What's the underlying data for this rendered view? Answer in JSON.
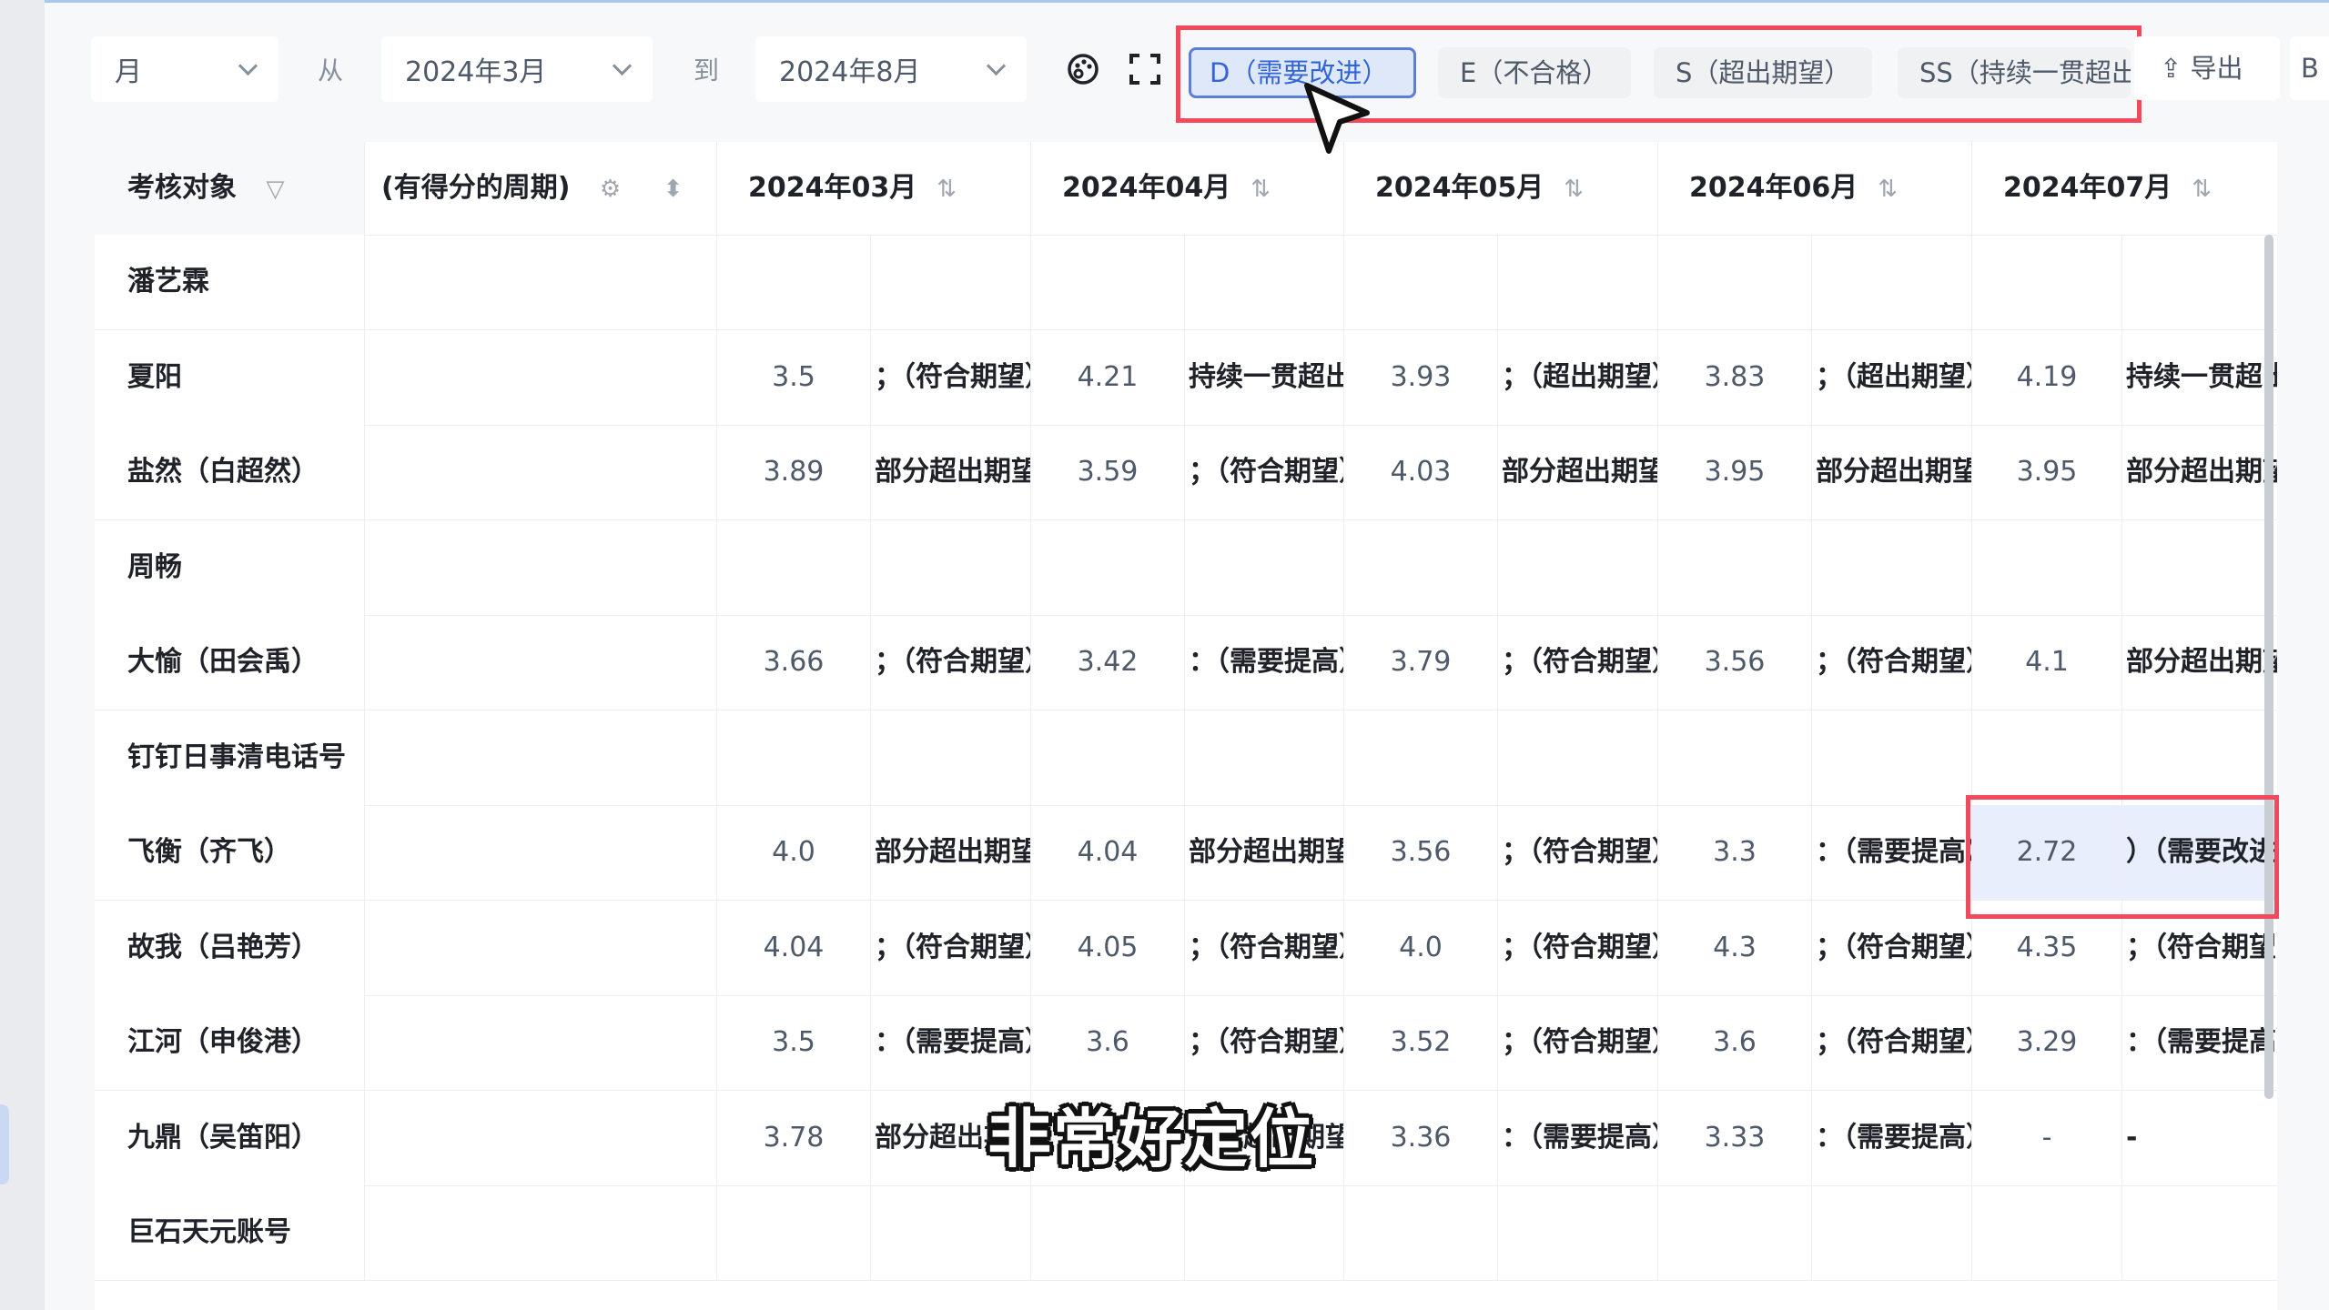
{
  "filters": {
    "period_type": "月",
    "from_label": "从",
    "from_value": "2024年3月",
    "to_label": "到",
    "to_value": "2024年8月"
  },
  "grade_chips": [
    {
      "label": "D（需要改进）",
      "active": true
    },
    {
      "label": "E（不合格）",
      "active": false
    },
    {
      "label": "S（超出期望）",
      "active": false
    },
    {
      "label": "SS（持续一贯超出期望）",
      "active": false
    }
  ],
  "toolbar": {
    "palette_icon": "palette-icon",
    "fullscreen_icon": "fullscreen-icon",
    "export_label": "导出",
    "extra_label": "B"
  },
  "table": {
    "headers": {
      "object": "考核对象",
      "period": "(有得分的周期)",
      "months": [
        "2024年03月",
        "2024年04月",
        "2024年05月",
        "2024年06月",
        "2024年07月"
      ]
    },
    "rows": [
      {
        "name": "潘艺霖",
        "cells": [
          [
            "",
            ""
          ],
          [
            "",
            ""
          ],
          [
            "",
            ""
          ],
          [
            "",
            ""
          ],
          [
            "",
            ""
          ]
        ]
      },
      {
        "name": "夏阳",
        "cells": [
          [
            "3.5",
            "；（符合期望）"
          ],
          [
            "4.21",
            "持续一贯超出期望"
          ],
          [
            "3.93",
            "；（超出期望）"
          ],
          [
            "3.83",
            "；（超出期望）"
          ],
          [
            "4.19",
            "持续一贯超出期望"
          ]
        ]
      },
      {
        "name": "盐然（白超然）",
        "cells": [
          [
            "3.89",
            "部分超出期望"
          ],
          [
            "3.59",
            "；（符合期望）"
          ],
          [
            "4.03",
            "部分超出期望"
          ],
          [
            "3.95",
            "部分超出期望"
          ],
          [
            "3.95",
            "部分超出期望"
          ]
        ]
      },
      {
        "name": "周畅",
        "cells": [
          [
            "",
            ""
          ],
          [
            "",
            ""
          ],
          [
            "",
            ""
          ],
          [
            "",
            ""
          ],
          [
            "",
            ""
          ]
        ]
      },
      {
        "name": "大愉（田会禹）",
        "cells": [
          [
            "3.66",
            "；（符合期望）"
          ],
          [
            "3.42",
            "：（需要提高）"
          ],
          [
            "3.79",
            "；（符合期望）"
          ],
          [
            "3.56",
            "；（符合期望）"
          ],
          [
            "4.1",
            "部分超出期望"
          ]
        ]
      },
      {
        "name": "钉钉日事清电话号",
        "cells": [
          [
            "",
            ""
          ],
          [
            "",
            ""
          ],
          [
            "",
            ""
          ],
          [
            "",
            ""
          ],
          [
            "",
            ""
          ]
        ]
      },
      {
        "name": "飞衡（齐飞）",
        "cells": [
          [
            "4.0",
            "部分超出期望"
          ],
          [
            "4.04",
            "部分超出期望"
          ],
          [
            "3.56",
            "；（符合期望）"
          ],
          [
            "3.3",
            "：（需要提高）"
          ],
          [
            "2.72",
            "）（需要改进）"
          ]
        ]
      },
      {
        "name": "故我（吕艳芳）",
        "cells": [
          [
            "4.04",
            "；（符合期望）"
          ],
          [
            "4.05",
            "；（符合期望）"
          ],
          [
            "4.0",
            "；（符合期望）"
          ],
          [
            "4.3",
            "；（符合期望）"
          ],
          [
            "4.35",
            "；（符合期望）"
          ]
        ]
      },
      {
        "name": "江河（申俊港）",
        "cells": [
          [
            "3.5",
            "：（需要提高）"
          ],
          [
            "3.6",
            "；（符合期望）"
          ],
          [
            "3.52",
            "；（符合期望）"
          ],
          [
            "3.6",
            "；（符合期望）"
          ],
          [
            "3.29",
            "：（需要提高）"
          ]
        ]
      },
      {
        "name": "九鼎（吴笛阳）",
        "cells": [
          [
            "3.78",
            "部分超出期望"
          ],
          [
            "",
            "部分超出期望"
          ],
          [
            "3.36",
            "：（需要提高）"
          ],
          [
            "3.33",
            "：（需要提高）"
          ],
          [
            "-",
            "-"
          ]
        ]
      },
      {
        "name": "巨石天元账号",
        "cells": [
          [
            "",
            ""
          ],
          [
            "",
            ""
          ],
          [
            "",
            ""
          ],
          [
            "",
            ""
          ],
          [
            "",
            ""
          ]
        ]
      }
    ]
  },
  "caption": "非常好定位"
}
